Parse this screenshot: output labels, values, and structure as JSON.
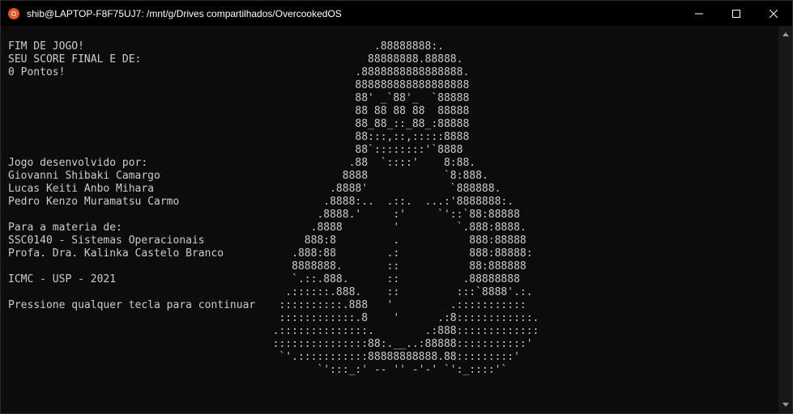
{
  "window": {
    "title": "shib@LAPTOP-F8F75UJ7: /mnt/g/Drives compartilhados/OvercookedOS",
    "icon": "ubuntu-icon",
    "controls": [
      "minimize-icon",
      "maximize-icon",
      "close-icon"
    ]
  },
  "terminal": {
    "text_lines": [
      "FIM DE JOGO!",
      "SEU SCORE FINAL E DE:",
      "0 Pontos!",
      "",
      "",
      "",
      "",
      "",
      "",
      "Jogo desenvolvido por:",
      "Giovanni Shibaki Camargo",
      "Lucas Keiti Anbo Mihara",
      "Pedro Kenzo Muramatsu Carmo",
      "",
      "Para a materia de:",
      "SSC0140 - Sistemas Operacionais",
      "Profa. Dra. Kalinka Castelo Branco",
      "",
      "ICMC - USP - 2021",
      "",
      "Pressione qualquer tecla para continuar"
    ],
    "ascii_art": [
      "                  .88888888:.",
      "                 88888888.88888.",
      "               .8888888888888888.",
      "               888888888888888888",
      "               88' _`88'_  `88888",
      "               88 88 88 88  88888",
      "               88_88_::_88_:88888",
      "               88:::,::,:::::8888",
      "               88`::::::::'`8888",
      "              .88  `::::'    8:88.",
      "             8888            `8:888.",
      "           .8888'             `888888.",
      "          .8888:..  .::.  ...:'8888888:.",
      "         .8888.'     :'     `'::`88:88888",
      "        .8888        '         `.888:8888.",
      "       888:8         .           888:88888",
      "     .888:88        .:           888:88888:",
      "     8888888.       ::           88:888888",
      "     `.::.888.      ::          .88888888",
      "    .::::::.888.    ::         :::`8888'.:.",
      "   ::::::::::.888   '         .:::::::::::",
      "   ::::::::::::.8    '      .:8::::::::::::.",
      "  .::::::::::::::.        .:888:::::::::::::",
      "  :::::::::::::::88:.__..:88888:::::::::::'",
      "   `'.:::::::::::88888888888.88:::::::::'",
      "         `':::_:' -- '' -'-' `':_::::'`"
    ]
  },
  "scrollbar": {
    "up_icon": "scroll-up-arrow-icon",
    "down_icon": "scroll-down-arrow-icon"
  },
  "colors": {
    "background": "#0c0c0c",
    "foreground": "#cccccc",
    "titlebar": "#000000",
    "ubuntu_orange": "#e95420"
  }
}
